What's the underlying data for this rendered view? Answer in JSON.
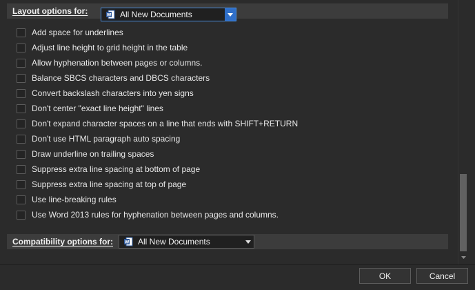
{
  "layout_section": {
    "label": "Layout options for:",
    "dropdown_value": "All New Documents"
  },
  "options": [
    {
      "label": "Add space for underlines",
      "checked": false
    },
    {
      "label": "Adjust line height to grid height in the table",
      "checked": false
    },
    {
      "label": "Allow hyphenation between pages or columns.",
      "checked": false
    },
    {
      "label": "Balance SBCS characters and DBCS characters",
      "checked": false
    },
    {
      "label": "Convert backslash characters into yen signs",
      "checked": false
    },
    {
      "label": "Don't center \"exact line height\" lines",
      "checked": false
    },
    {
      "label": "Don't expand character spaces on a line that ends with SHIFT+RETURN",
      "checked": false
    },
    {
      "label": "Don't use HTML paragraph auto spacing",
      "checked": false
    },
    {
      "label": "Draw underline on trailing spaces",
      "checked": false
    },
    {
      "label": "Suppress extra line spacing at bottom of page",
      "checked": false
    },
    {
      "label": "Suppress extra line spacing at top of page",
      "checked": false
    },
    {
      "label": "Use line-breaking rules",
      "checked": false
    },
    {
      "label": "Use Word 2013 rules for hyphenation between pages and columns.",
      "checked": false
    }
  ],
  "compat_section": {
    "label": "Compatibility options for:",
    "dropdown_value": "All New Documents"
  },
  "buttons": {
    "ok": "OK",
    "cancel": "Cancel"
  },
  "icons": {
    "document": "word-document-icon",
    "dropdown": "chevron-down-icon"
  },
  "colors": {
    "accent": "#2f6fc9",
    "word_blue": "#2b579a"
  }
}
